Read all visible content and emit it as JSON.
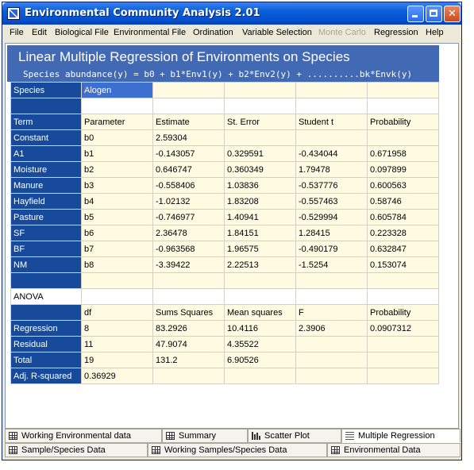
{
  "window": {
    "title": "Environmental Community Analysis 2.01"
  },
  "menu": [
    "File",
    "Edit",
    "Biological File",
    "Environmental File",
    "Ordination",
    "Variable Selection",
    "Monte Carlo",
    "Regression",
    "Help"
  ],
  "menu_disabled": "Monte Carlo",
  "header": {
    "title": "Linear Multiple Regression of Environments on Species",
    "subtitle": "Species abundance(y) = b0 + b1*Env1(y) + b2*Env2(y) + ..........bk*Envk(y)"
  },
  "grid": {
    "species_label": "Species",
    "species_value": "Alogen",
    "term_header": [
      "Term",
      "Parameter",
      "Estimate",
      "St. Error",
      "Student t",
      "Probability"
    ],
    "terms": [
      [
        "Constant",
        "b0",
        "2.59304",
        "",
        "",
        ""
      ],
      [
        "A1",
        "b1",
        "-0.143057",
        "0.329591",
        "-0.434044",
        "0.671958"
      ],
      [
        "Moisture",
        "b2",
        "0.646747",
        "0.360349",
        "1.79478",
        "0.097899"
      ],
      [
        "Manure",
        "b3",
        "-0.558406",
        "1.03836",
        "-0.537776",
        "0.600563"
      ],
      [
        "Hayfield",
        "b4",
        "-1.02132",
        "1.83208",
        "-0.557463",
        "0.58746"
      ],
      [
        "Pasture",
        "b5",
        "-0.746977",
        "1.40941",
        "-0.529994",
        "0.605784"
      ],
      [
        "SF",
        "b6",
        "2.36478",
        "1.84151",
        "1.28415",
        "0.223328"
      ],
      [
        "BF",
        "b7",
        "-0.963568",
        "1.96575",
        "-0.490179",
        "0.632847"
      ],
      [
        "NM",
        "b8",
        "-3.39422",
        "2.22513",
        "-1.5254",
        "0.153074"
      ]
    ],
    "anova_label": "ANOVA",
    "anova_header": [
      "",
      "df",
      "Sums Squares",
      "Mean squares",
      "F",
      "Probability"
    ],
    "anova": [
      [
        "Regression",
        "8",
        "83.2926",
        "10.4116",
        "2.3906",
        "0.0907312"
      ],
      [
        "Residual",
        "11",
        "47.9074",
        "4.35522",
        "",
        ""
      ],
      [
        "Total",
        "19",
        "131.2",
        "6.90526",
        "",
        ""
      ],
      [
        "Adj. R-squared",
        "0.36929",
        "",
        "",
        "",
        ""
      ]
    ]
  },
  "tabs": {
    "row1": [
      {
        "label": "Working Environmental data",
        "icon": "grid-icon"
      },
      {
        "label": "Summary",
        "icon": "grid-icon"
      },
      {
        "label": "Scatter Plot",
        "icon": "bar-chart-icon"
      },
      {
        "label": "Multiple Regression",
        "icon": "lines-icon",
        "active": true
      }
    ],
    "row2": [
      {
        "label": "Sample/Species Data",
        "icon": "grid-icon"
      },
      {
        "label": "Working Samples/Species Data",
        "icon": "grid-icon"
      },
      {
        "label": "Environmental Data",
        "icon": "grid-icon"
      }
    ]
  },
  "colors": {
    "header_bg": "#4169b4",
    "row_header_bg": "#174a9a",
    "cell_bg": "#fffbe2",
    "titlebar": "#0a5fd8"
  }
}
